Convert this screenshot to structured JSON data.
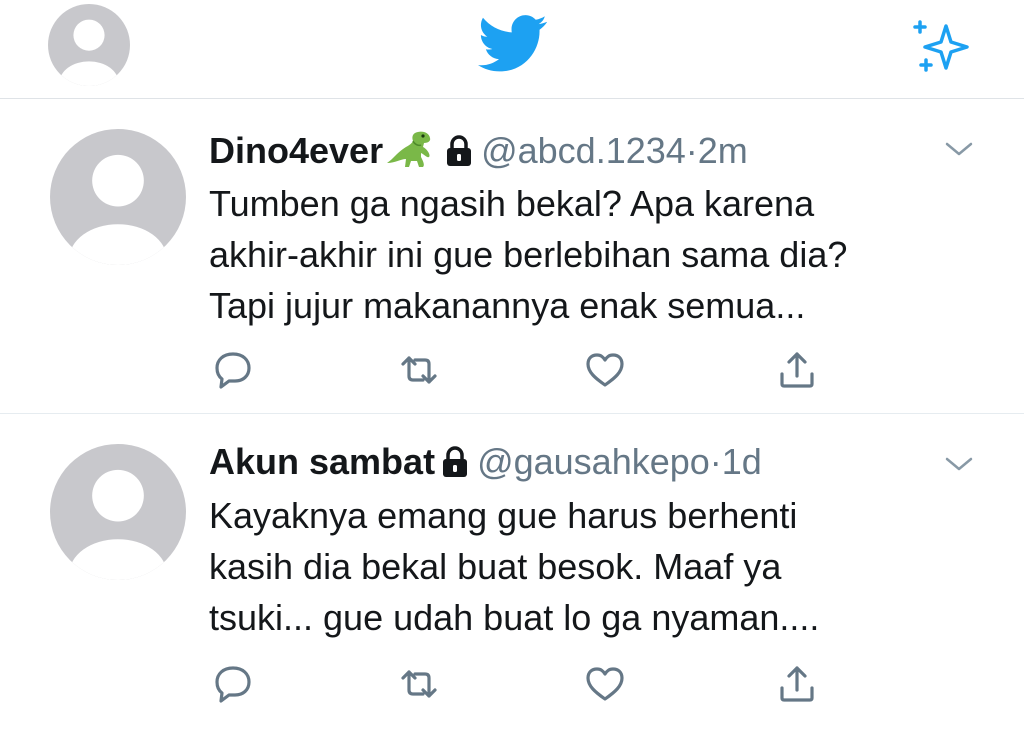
{
  "header": {
    "profile_icon": "user-avatar-icon",
    "logo_icon": "twitter-bird-icon",
    "sparkle_icon": "sparkle-icon"
  },
  "tweets": [
    {
      "display_name": "Dino4ever",
      "name_emoji": "dinosaur-emoji-icon",
      "protected_icon": "lock-icon",
      "handle": "@abcd.1234",
      "separator": "·",
      "time": "2m",
      "lines": [
        "Tumben ga ngasih bekal? Apa karena",
        "akhir-akhir ini gue berlebihan sama dia?",
        "Tapi jujur makanannya enak semua..."
      ]
    },
    {
      "display_name": "Akun sambat",
      "protected_icon": "lock-icon",
      "handle": "@gausahkepo",
      "separator": "·",
      "time": "1d",
      "lines": [
        "Kayaknya emang gue harus berhenti",
        "kasih dia bekal buat besok. Maaf ya",
        "tsuki... gue udah buat lo ga nyaman...."
      ]
    }
  ],
  "actions": [
    "reply-icon",
    "retweet-icon",
    "like-icon",
    "share-icon"
  ],
  "colors": {
    "brand_blue": "#1da1f2",
    "text_primary": "#14171a",
    "text_secondary": "#657786",
    "avatar_gray": "#c8c8cc",
    "divider": "#e6ecf0"
  }
}
